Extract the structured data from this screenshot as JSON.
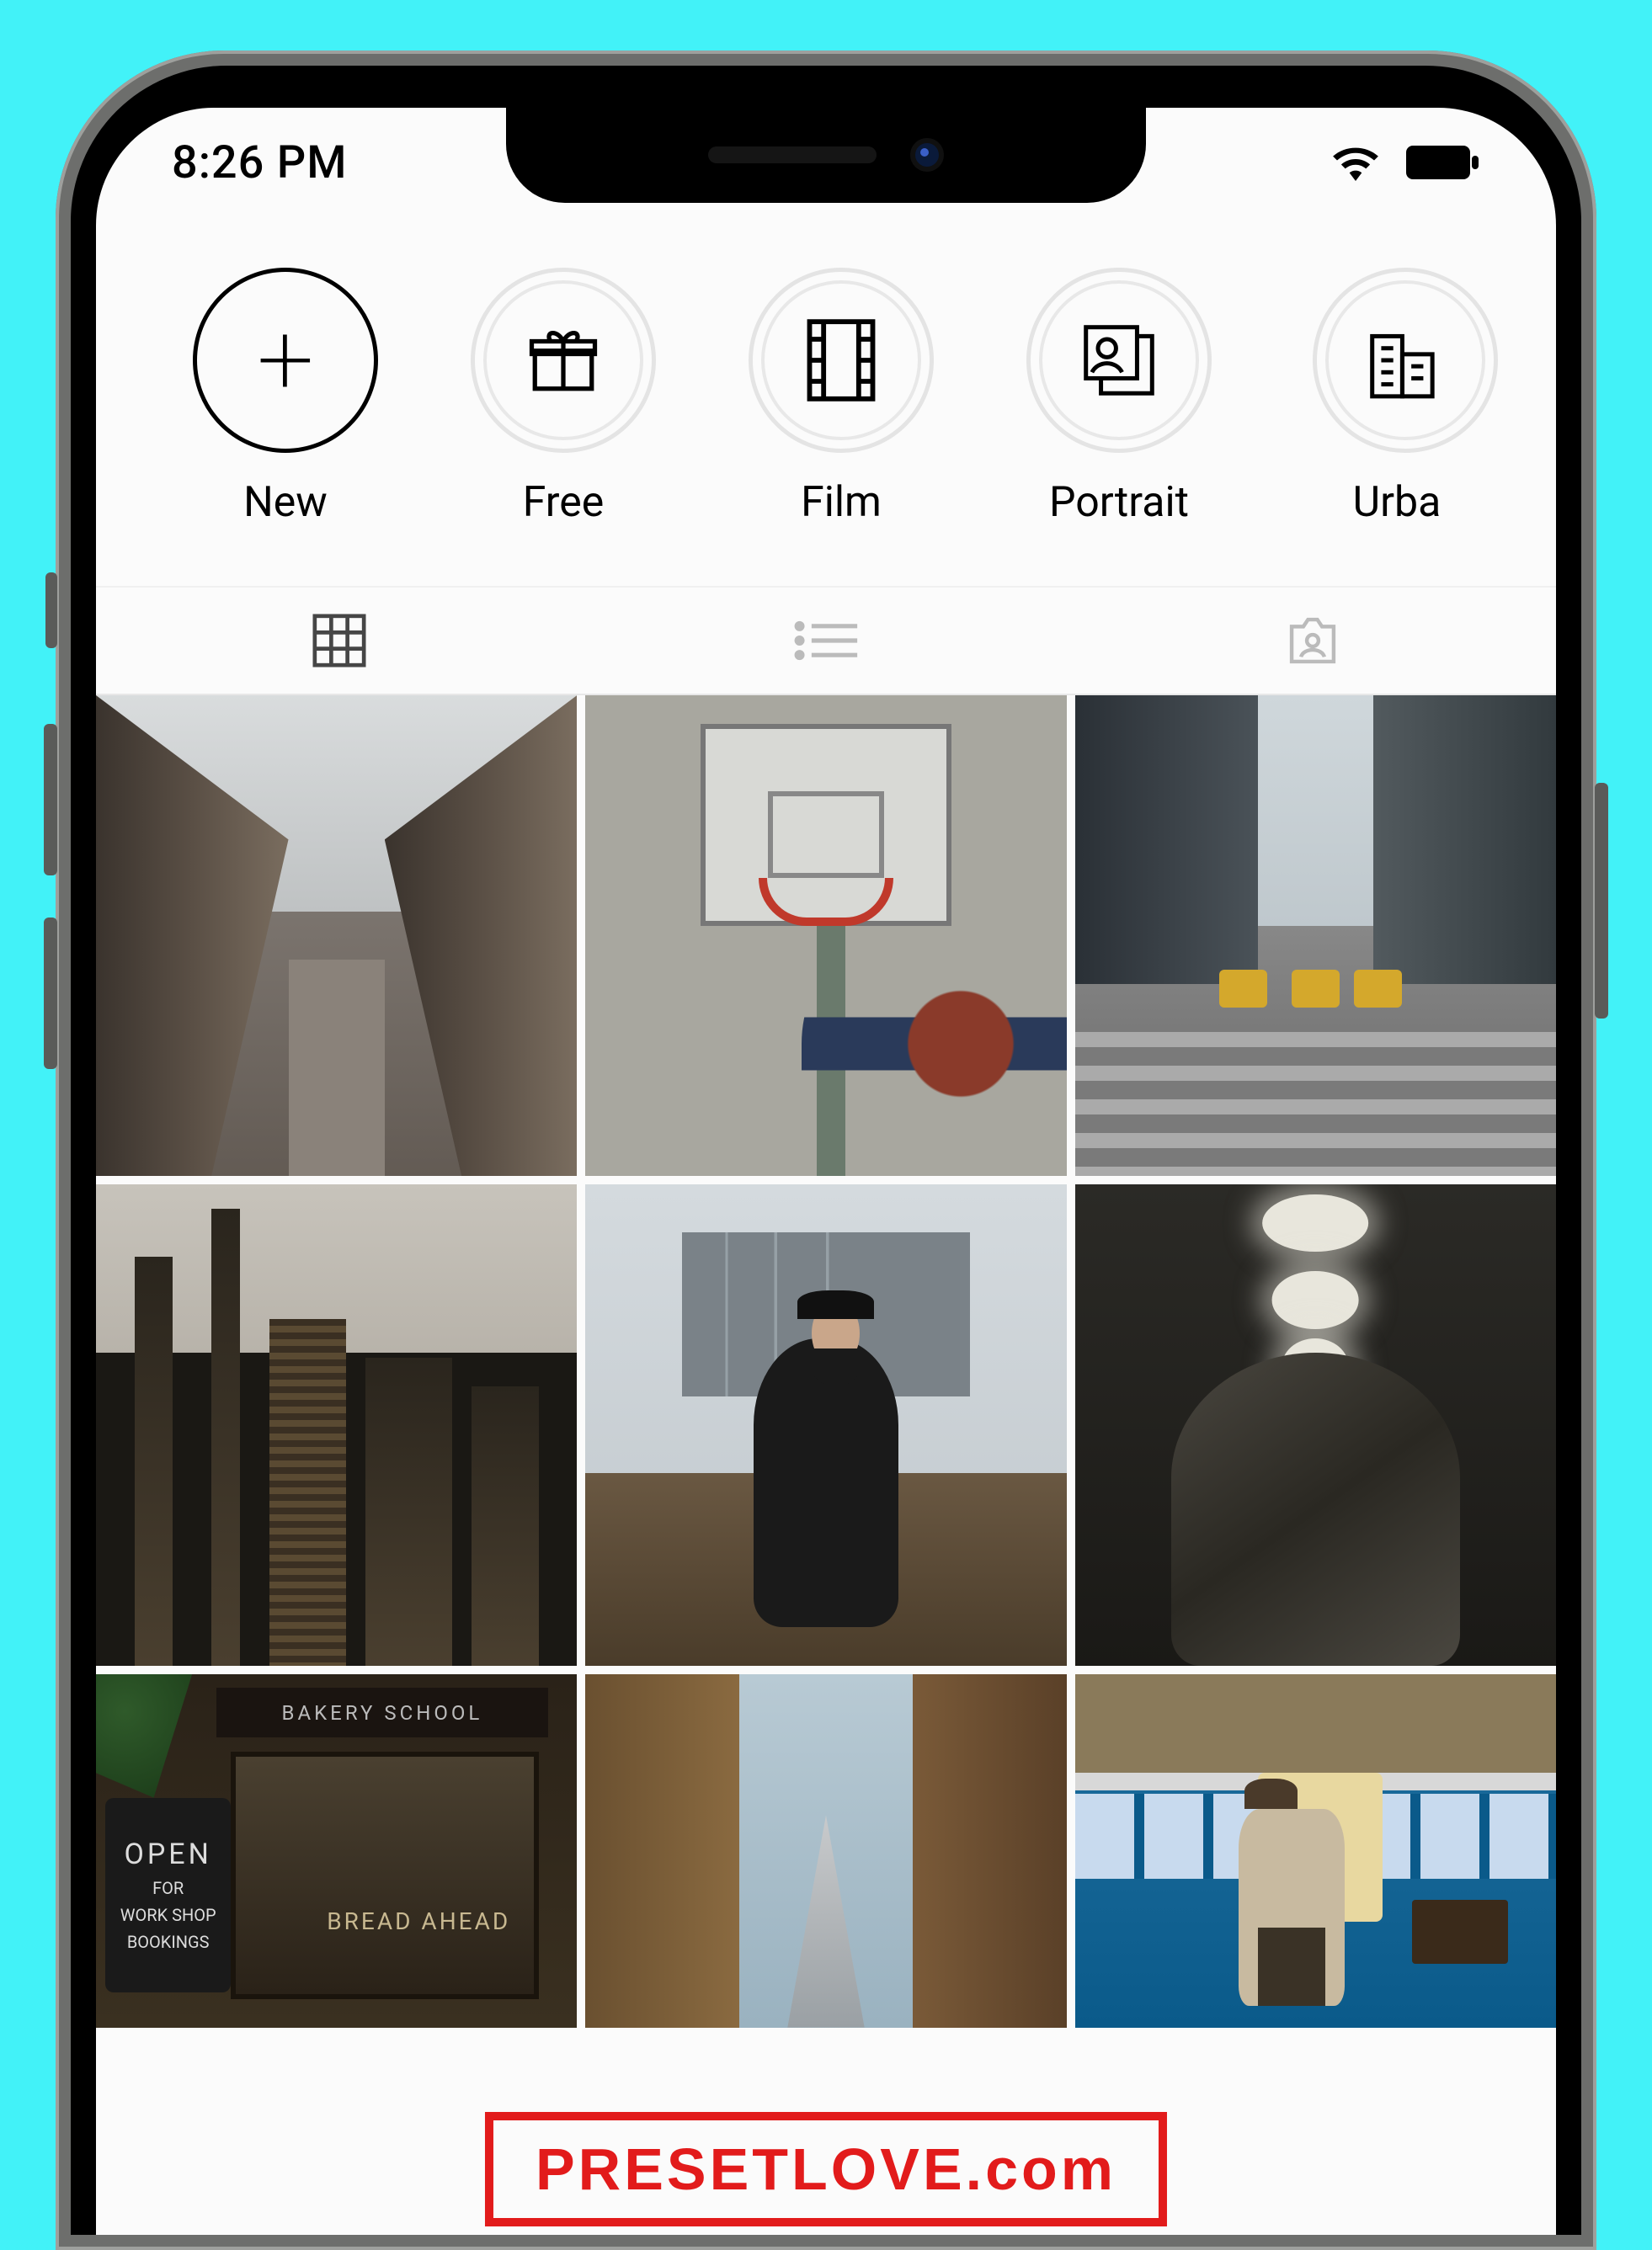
{
  "status": {
    "time": "8:26 PM"
  },
  "highlights": [
    {
      "label": "New",
      "icon": "plus"
    },
    {
      "label": "Free",
      "icon": "gift"
    },
    {
      "label": "Film",
      "icon": "film"
    },
    {
      "label": "Portrait",
      "icon": "portrait"
    },
    {
      "label": "Urba",
      "icon": "buildings"
    }
  ],
  "bakery_text": {
    "awning": "BAKERY SCHOOL",
    "sign_open": "OPEN",
    "sign_line1": "FOR",
    "sign_line2": "WORK SHOP",
    "sign_line3": "BOOKINGS",
    "window": "BREAD AHEAD"
  },
  "watermark": "PRESETLOVE.com"
}
